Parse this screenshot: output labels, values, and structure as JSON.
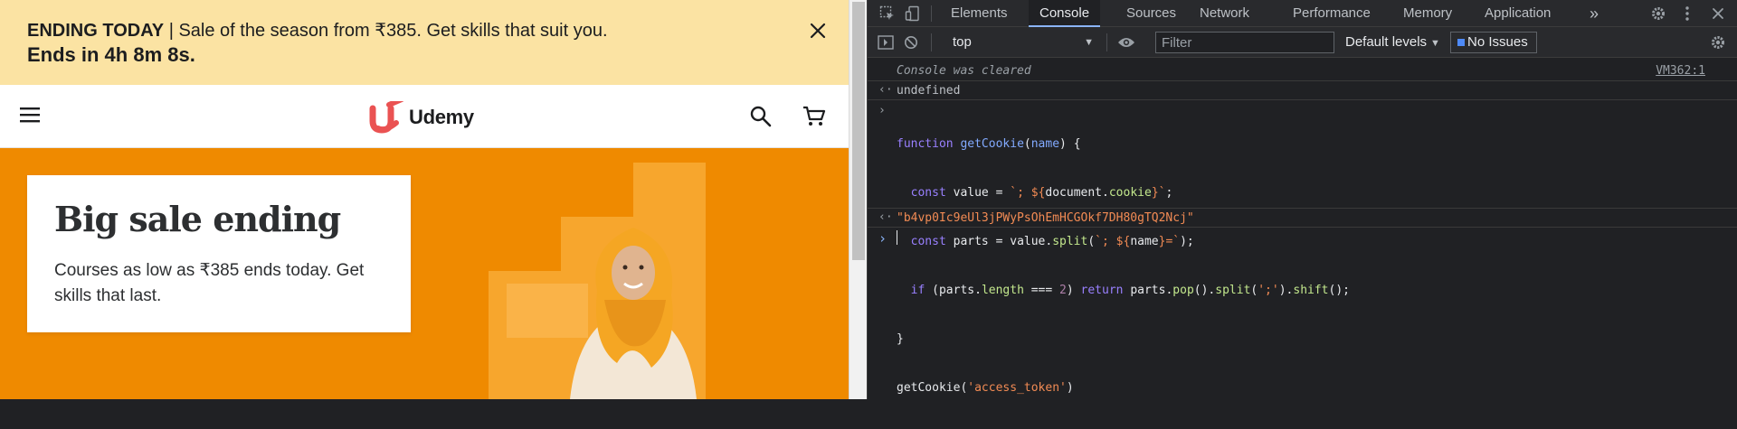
{
  "site": {
    "promo": {
      "heading": "ENDING TODAY",
      "separator": " | ",
      "message": "Sale of the season from ₹385. Get skills that suit you.",
      "countdown": "Ends in 4h 8m 8s."
    },
    "header": {
      "brand": "Udemy"
    },
    "hero": {
      "title": "Big sale ending",
      "subtitle": "Courses as low as ₹385 ends today. Get skills that last."
    },
    "colors": {
      "promo_bg": "#fbe3a3",
      "hero_bg": "#ef8a00",
      "brand_red": "#a435f0"
    }
  },
  "devtools": {
    "tabs": [
      "Elements",
      "Console",
      "Sources",
      "Network",
      "Performance",
      "Memory",
      "Application"
    ],
    "active_tab": "Console",
    "more_tabs_glyph": "»",
    "toolbar": {
      "context": "top",
      "filter_placeholder": "Filter",
      "levels": "Default levels",
      "issues": "No Issues"
    },
    "console": {
      "cleared_msg": "Console was cleared",
      "cleared_src": "VM362:1",
      "undefined_result": "undefined",
      "code_lines": [
        "function getCookie(name) {",
        "  const value = `; ${document.cookie}`;",
        "  const parts = value.split(`; ${name}=`);",
        "  if (parts.length === 2) return parts.pop().split(';').shift();",
        "}",
        "getCookie('access_token')"
      ],
      "result": "\"b4vp0Ic9eUl3jPWyPsOhEmHCGOkf7DH80gTQ2Ncj\""
    }
  }
}
